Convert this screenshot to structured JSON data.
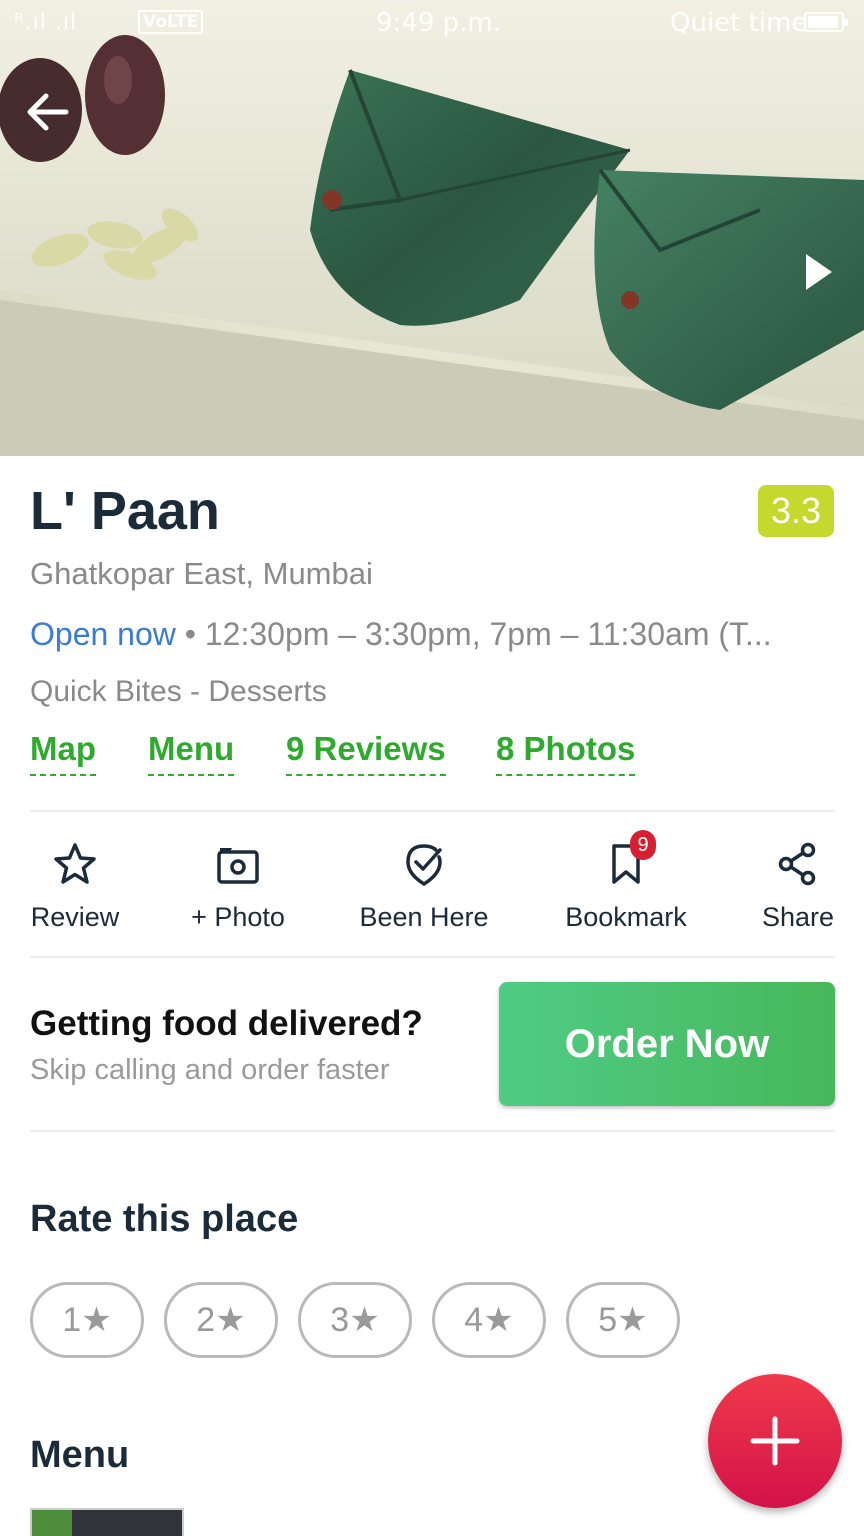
{
  "status_bar": {
    "signal": "ᴿ.ıl .ıl",
    "network": "VoLTE",
    "time": "9:49 p.m.",
    "mode": "Quiet time",
    "battery_level": 0.85
  },
  "hero": {
    "back_icon": "arrow-left-icon",
    "next_icon": "play-right-icon"
  },
  "restaurant": {
    "name": "L' Paan",
    "rating": "3.3",
    "rating_color": "#c4d82e",
    "locality": "Ghatkopar East, Mumbai",
    "open_status": "Open now",
    "timings": " • 12:30pm – 3:30pm, 7pm – 11:30am (T...",
    "cuisines": "Quick Bites - Desserts"
  },
  "links": {
    "map": "Map",
    "menu": "Menu",
    "reviews": "9 Reviews",
    "photos": "8 Photos"
  },
  "actions": {
    "review": "Review",
    "photo": "+ Photo",
    "been_here": "Been Here",
    "bookmark": "Bookmark",
    "bookmark_count": "9",
    "share": "Share"
  },
  "delivery": {
    "title": "Getting food delivered?",
    "subtitle": "Skip calling and order faster",
    "button": "Order Now"
  },
  "rate": {
    "title": "Rate this place",
    "options": [
      "1★",
      "2★",
      "3★",
      "4★",
      "5★"
    ]
  },
  "menu_section": {
    "title": "Menu"
  },
  "fab": {
    "icon": "plus-icon",
    "color": "#e0203f"
  },
  "colors": {
    "green_link": "#2eaa2e",
    "blue_open": "#3a7bd5",
    "order_button": "#4cc470"
  }
}
